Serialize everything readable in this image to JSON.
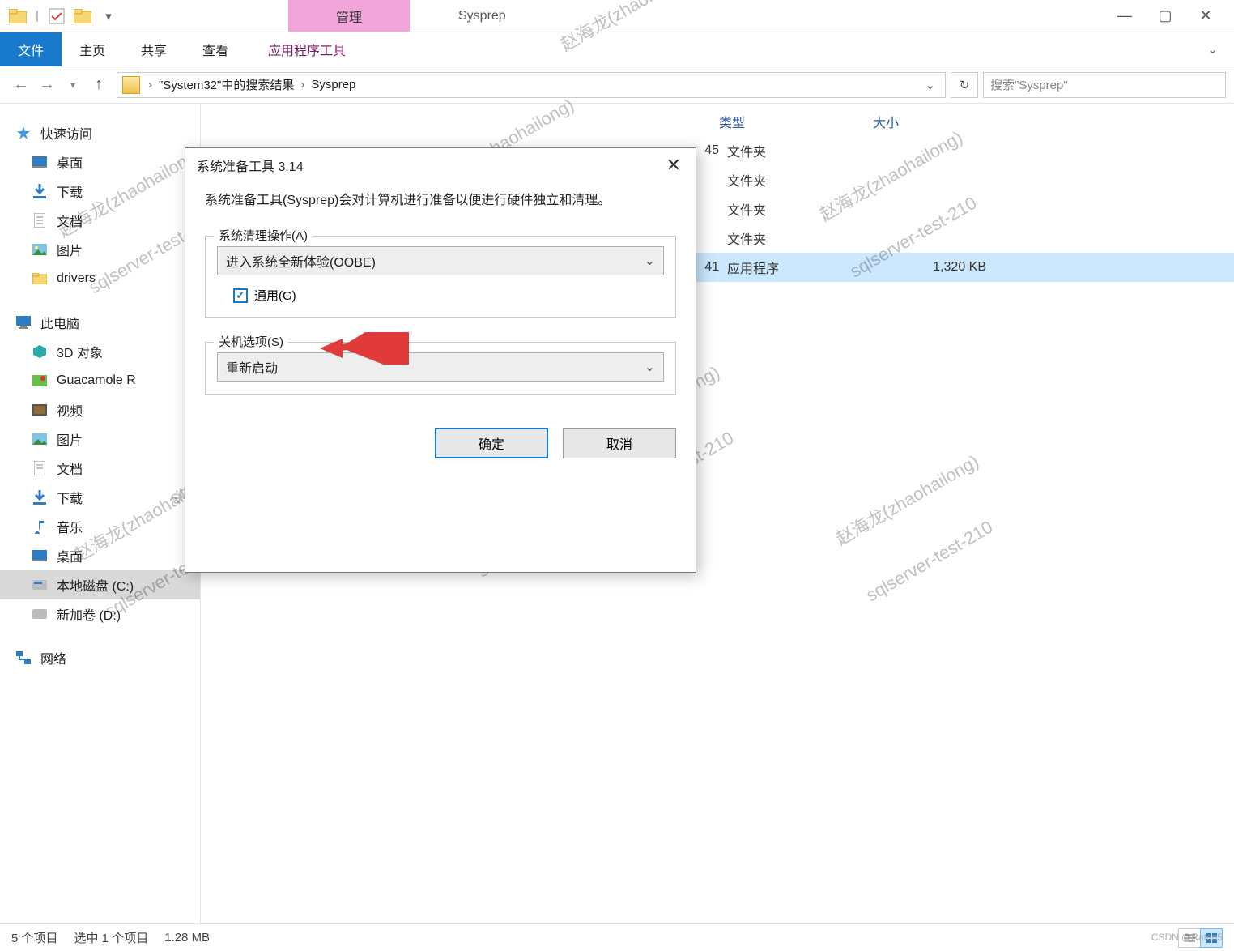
{
  "window": {
    "title": "Sysprep",
    "context_tab": "管理"
  },
  "ribbon": {
    "file": "文件",
    "home": "主页",
    "share": "共享",
    "view": "查看",
    "apptools": "应用程序工具"
  },
  "address": {
    "crumb1": "\"System32\"中的搜索结果",
    "crumb2": "Sysprep"
  },
  "search": {
    "placeholder": "搜索\"Sysprep\""
  },
  "navpane": {
    "quick": "快速访问",
    "desktop": "桌面",
    "downloads": "下载",
    "documents": "文档",
    "pictures": "图片",
    "drivers": "drivers",
    "thispc": "此电脑",
    "objects3d": "3D 对象",
    "guacamole": "Guacamole R",
    "videos": "视频",
    "pictures2": "图片",
    "documents2": "文档",
    "downloads2": "下载",
    "music": "音乐",
    "desktop2": "桌面",
    "cdisk": "本地磁盘 (C:)",
    "ddisk": "新加卷 (D:)",
    "network": "网络"
  },
  "columns": {
    "type": "类型",
    "size": "大小"
  },
  "rows": [
    {
      "time_tail": "45",
      "type": "文件夹",
      "size": ""
    },
    {
      "time_tail": "",
      "type": "文件夹",
      "size": ""
    },
    {
      "time_tail": "",
      "type": "文件夹",
      "size": ""
    },
    {
      "time_tail": "",
      "type": "文件夹",
      "size": ""
    },
    {
      "time_tail": "41",
      "type": "应用程序",
      "size": "1,320 KB"
    }
  ],
  "status": {
    "items": "5 个项目",
    "selected": "选中 1 个项目",
    "size": "1.28 MB"
  },
  "dialog": {
    "title": "系统准备工具 3.14",
    "desc": "系统准备工具(Sysprep)会对计算机进行准备以便进行硬件独立和清理。",
    "group1": "系统清理操作(A)",
    "combo1": "进入系统全新体验(OOBE)",
    "checkbox": "通用(G)",
    "group2": "关机选项(S)",
    "combo2": "重新启动",
    "ok": "确定",
    "cancel": "取消"
  },
  "watermarks": {
    "a": "赵海龙(zhaohailong)",
    "b": "sqlserver-test-210",
    "credit": "CSDN @Raten5"
  }
}
